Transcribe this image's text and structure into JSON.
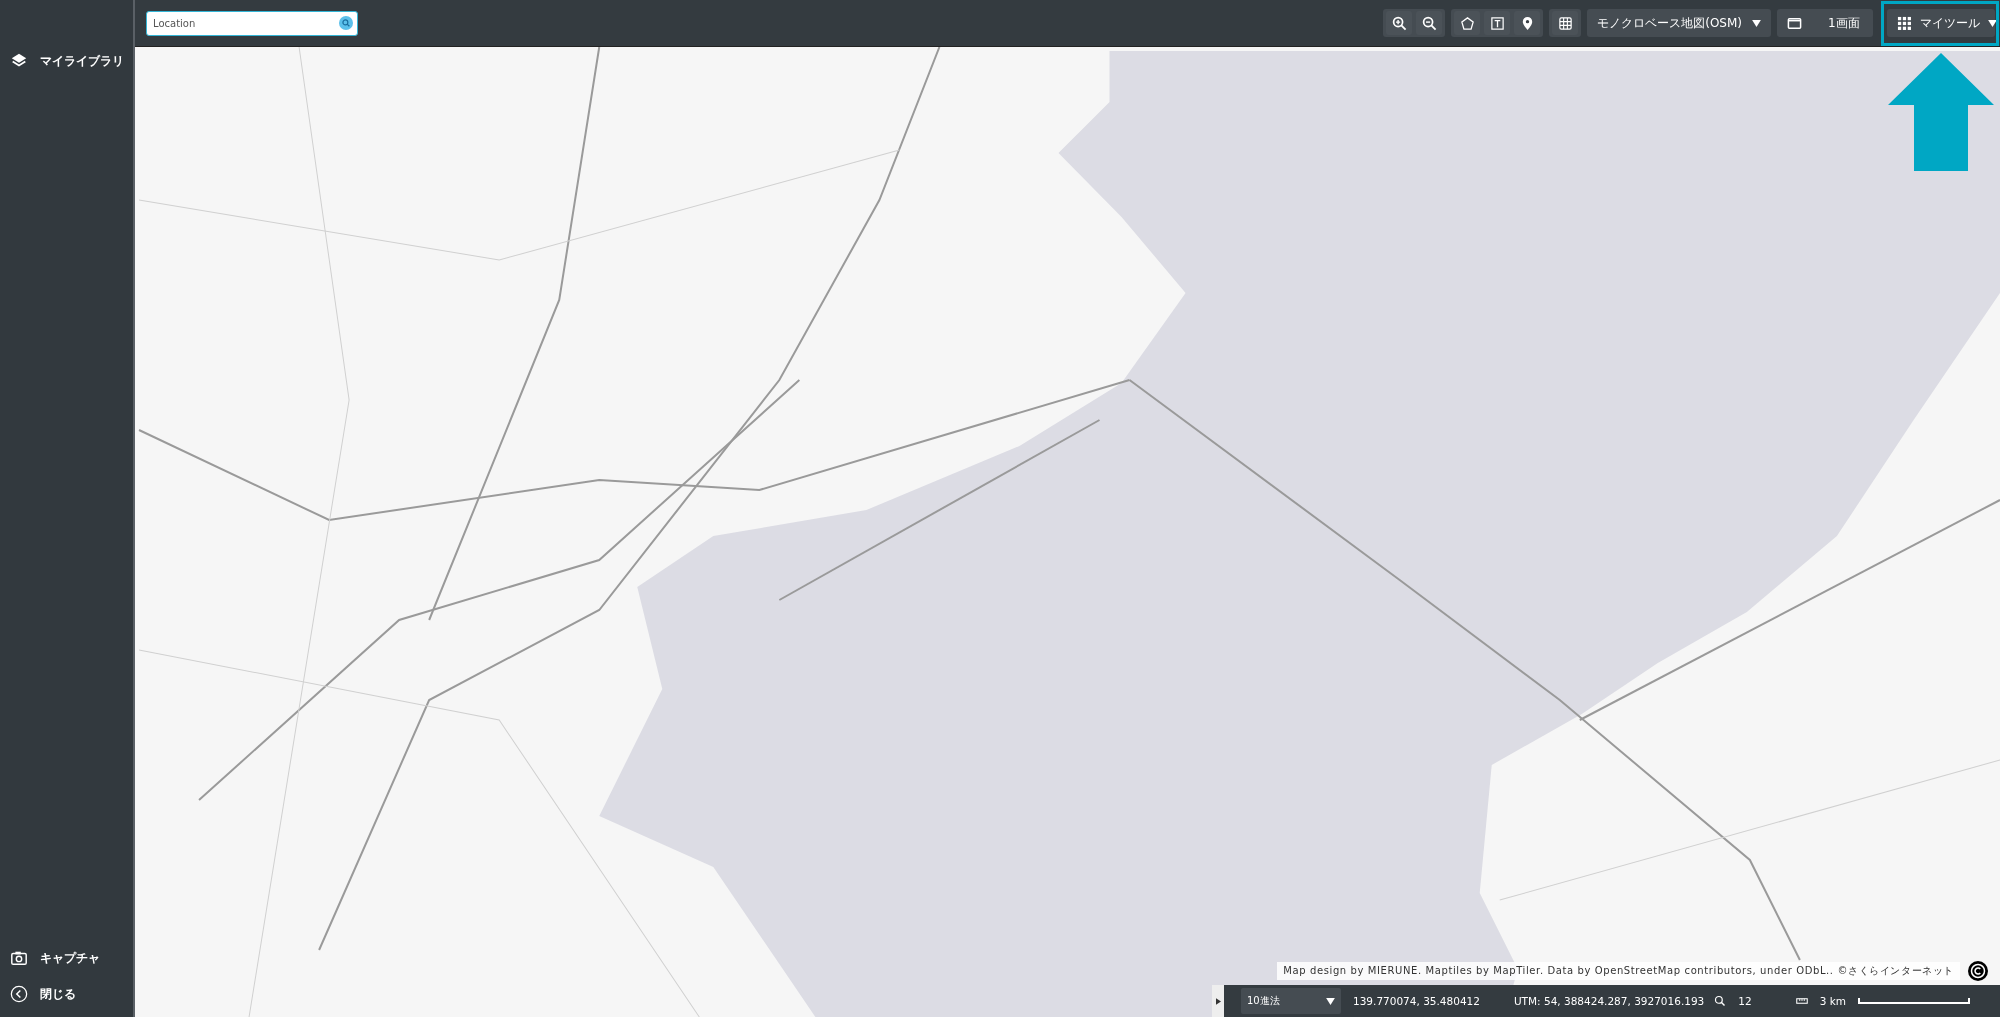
{
  "sidebar": {
    "items": [
      {
        "kind": "layers",
        "label": "マイライブラリ"
      }
    ],
    "bottom_items": [
      {
        "kind": "camera",
        "label": "キャプチャ"
      },
      {
        "kind": "back",
        "label": "閉じる"
      }
    ]
  },
  "search": {
    "placeholder": "Location"
  },
  "toolbar": {
    "basemap": "モノクロベース地図(OSM)",
    "screen_layout": "1画面",
    "my_tools": "マイツール"
  },
  "attribution": "Map design by MIERUNE. Maptiles by MapTiler. Data by OpenStreetMap contributors, under ODbL.. ©さくらインターネット",
  "status_bar": {
    "projection": "10進法",
    "coordinates": "139.770074, 35.480412",
    "utm": "UTM: 54, 388424.287, 3927016.193",
    "zoom": "12",
    "scale": "3 km"
  }
}
